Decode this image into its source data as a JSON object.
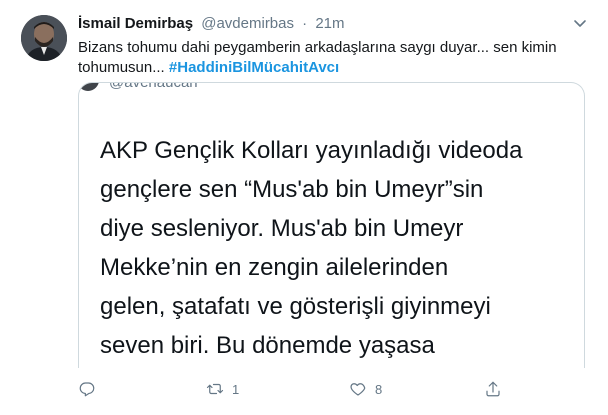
{
  "tweet": {
    "author_name": "İsmail Demirbaş",
    "handle": "@avdemirbas",
    "separator": "·",
    "time": "21m",
    "text": "Bizans tohumu dahi peygamberin arkadaşlarına saygı duyar... sen kimin tohumusun... ",
    "hashtag": "#HaddiniBilMücahitAvcı"
  },
  "quoted": {
    "header_fragment": "@avehaucan",
    "lines": [
      "AKP Gençlik Kolları yayınladığı videoda",
      "gençlere sen “Mus'ab bin Umeyr”sin",
      "diye sesleniyor. Mus'ab bin Umeyr",
      "Mekke’nin en zengin ailelerinden",
      "gelen, şatafatı ve gösterişli giyinmeyi",
      "seven biri. Bu dönemde yaşasa"
    ]
  },
  "actions": {
    "reply_count": "",
    "retweet_count": "1",
    "like_count": "8",
    "share_count": ""
  },
  "colors": {
    "text": "#14171a",
    "secondary": "#657786",
    "link": "#1b95e0",
    "border": "#cfd9de"
  },
  "icons": [
    "chevron-down-icon",
    "reply-icon",
    "retweet-icon",
    "like-icon",
    "share-icon"
  ]
}
